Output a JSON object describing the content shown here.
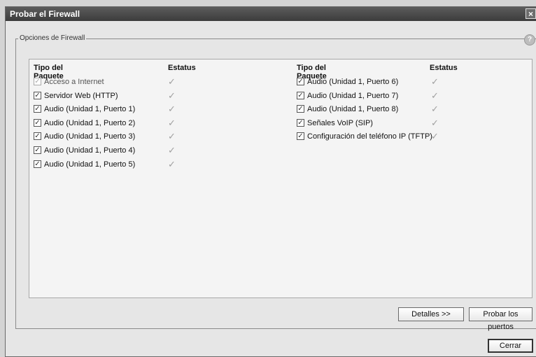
{
  "window": {
    "title": "Probar el Firewall",
    "close_glyph": "×"
  },
  "group": {
    "legend": "Opciones de Firewall",
    "help_glyph": "?"
  },
  "columns": {
    "type_header": "Tipo del Paquete",
    "status_header": "Estatus"
  },
  "left_items": [
    {
      "label": "Acceso a Internet",
      "checked": true,
      "disabled": true,
      "status": "check-icon"
    },
    {
      "label": "Servidor Web (HTTP)",
      "checked": true,
      "disabled": false,
      "status": "check-icon"
    },
    {
      "label": "Audio (Unidad 1, Puerto 1)",
      "checked": true,
      "disabled": false,
      "status": "check-icon"
    },
    {
      "label": "Audio (Unidad 1, Puerto 2)",
      "checked": true,
      "disabled": false,
      "status": "check-icon"
    },
    {
      "label": "Audio (Unidad 1, Puerto 3)",
      "checked": true,
      "disabled": false,
      "status": "check-icon"
    },
    {
      "label": "Audio (Unidad 1, Puerto 4)",
      "checked": true,
      "disabled": false,
      "status": "check-icon"
    },
    {
      "label": "Audio (Unidad 1, Puerto 5)",
      "checked": true,
      "disabled": false,
      "status": "check-icon"
    }
  ],
  "right_items": [
    {
      "label": "Audio (Unidad 1, Puerto 6)",
      "checked": true,
      "disabled": false,
      "status": "check-icon"
    },
    {
      "label": "Audio (Unidad 1, Puerto 7)",
      "checked": true,
      "disabled": false,
      "status": "check-icon"
    },
    {
      "label": "Audio (Unidad 1, Puerto 8)",
      "checked": true,
      "disabled": false,
      "status": "check-icon"
    },
    {
      "label": "Señales VoIP (SIP)",
      "checked": true,
      "disabled": false,
      "status": "check-icon"
    },
    {
      "label": "Configuración del teléfono IP (TFTP)",
      "checked": true,
      "disabled": false,
      "status": "check-icon"
    }
  ],
  "buttons": {
    "details": "Detalles >>",
    "test_ports": "Probar los puertos",
    "close": "Cerrar"
  },
  "colors": {
    "titlebar": "#4a4a4a",
    "status_check": "#a0a0a0"
  }
}
